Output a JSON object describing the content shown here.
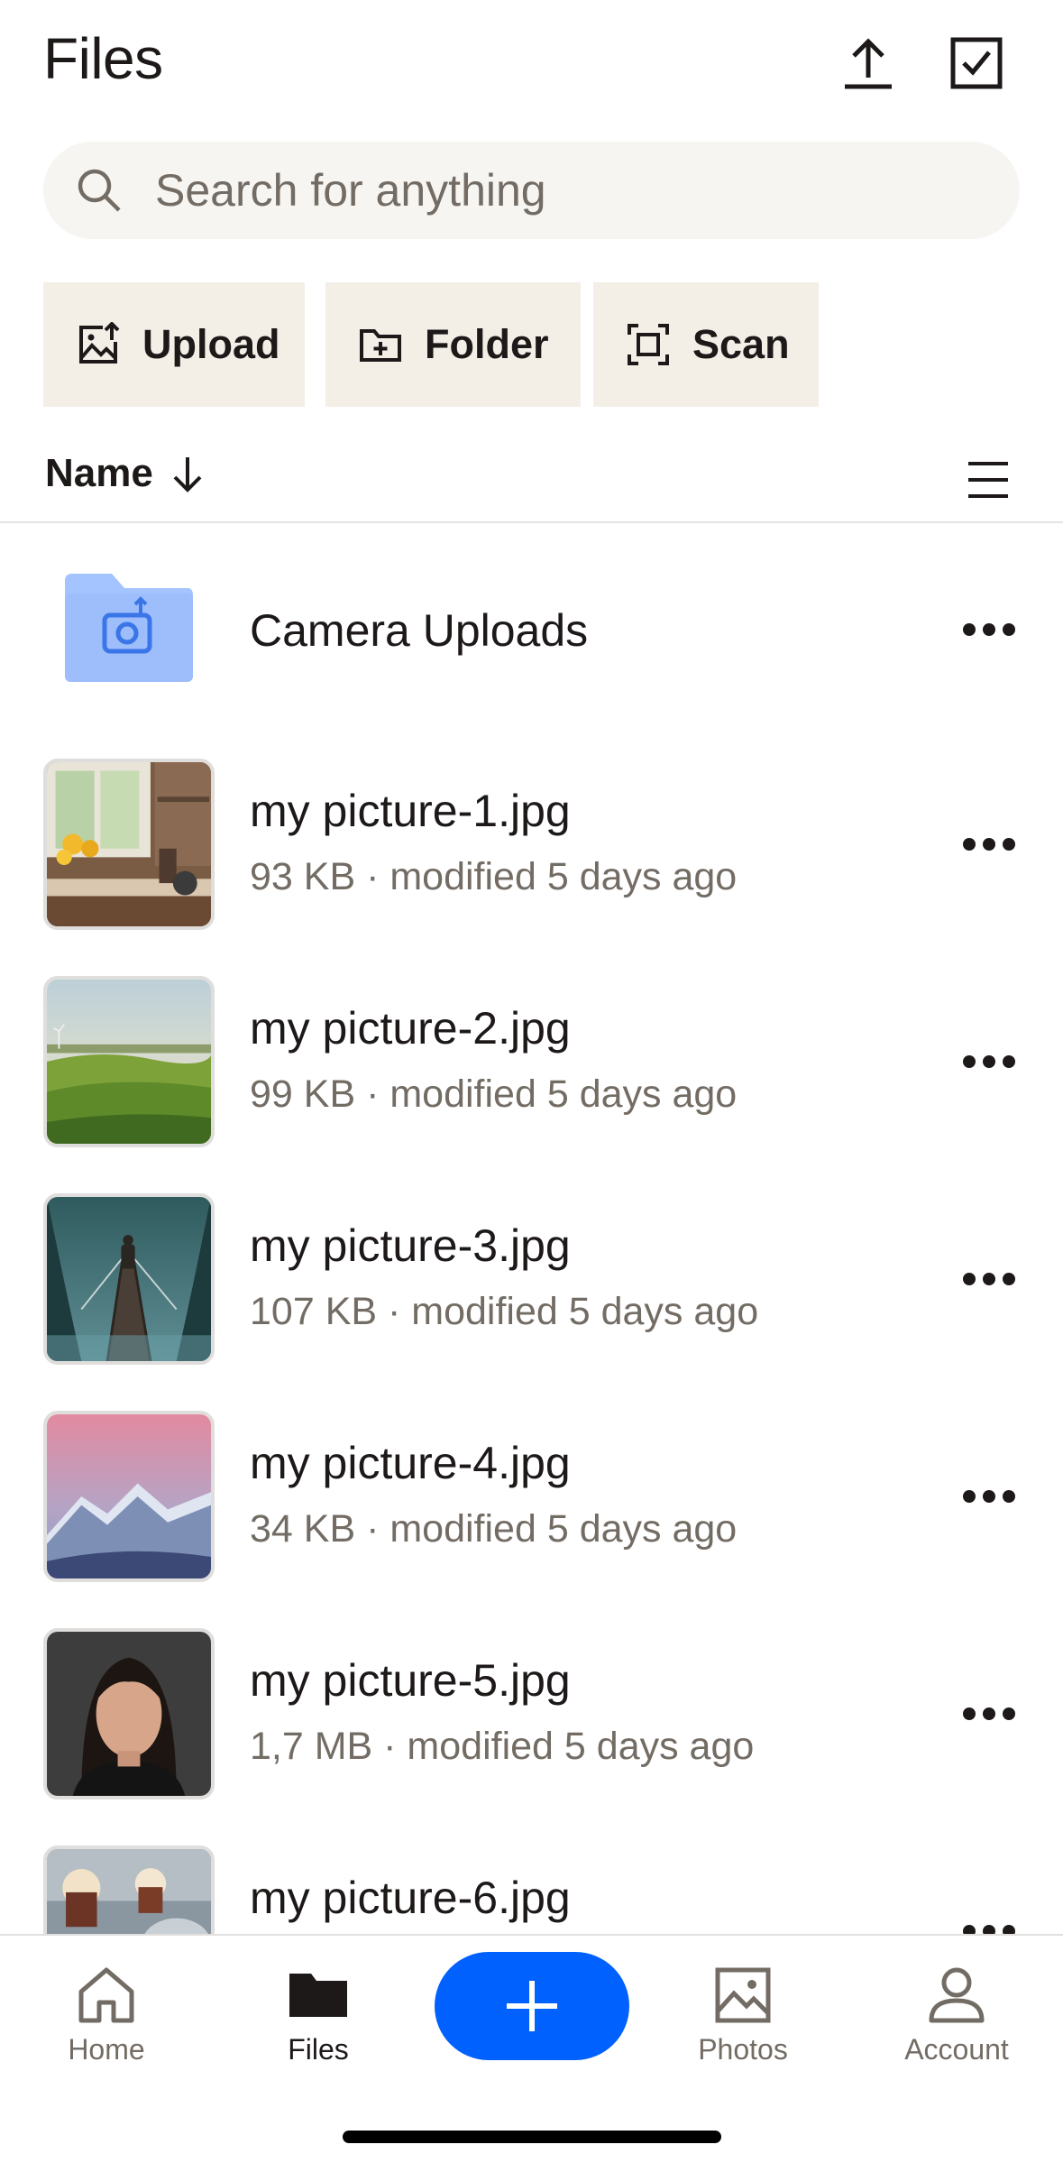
{
  "header": {
    "title": "Files"
  },
  "search": {
    "placeholder": "Search for anything"
  },
  "actions": [
    {
      "label": "Upload",
      "icon": "upload-image-icon"
    },
    {
      "label": "Folder",
      "icon": "new-folder-icon"
    },
    {
      "label": "Scan",
      "icon": "scan-icon"
    }
  ],
  "sort": {
    "label": "Name"
  },
  "files": [
    {
      "name": "Camera Uploads",
      "meta": "",
      "icon": "camera-folder-icon"
    },
    {
      "name": "my picture-1.jpg",
      "meta": "93 KB · modified 5 days ago"
    },
    {
      "name": "my picture-2.jpg",
      "meta": "99 KB · modified 5 days ago"
    },
    {
      "name": "my picture-3.jpg",
      "meta": "107 KB · modified 5 days ago"
    },
    {
      "name": "my picture-4.jpg",
      "meta": "34 KB · modified 5 days ago"
    },
    {
      "name": "my picture-5.jpg",
      "meta": "1,7 MB · modified 5 days ago"
    },
    {
      "name": "my picture-6.jpg",
      "meta": ""
    }
  ],
  "nav": [
    {
      "label": "Home",
      "icon": "home-icon"
    },
    {
      "label": "Files",
      "icon": "folder-icon"
    },
    {
      "label": "Photos",
      "icon": "photos-icon"
    },
    {
      "label": "Account",
      "icon": "account-icon"
    }
  ],
  "colors": {
    "accent": "#0061fe",
    "chip_bg": "#f3efe7",
    "search_bg": "#f7f5f2",
    "muted_text": "#736c64",
    "folder": "#a3c4ff"
  }
}
